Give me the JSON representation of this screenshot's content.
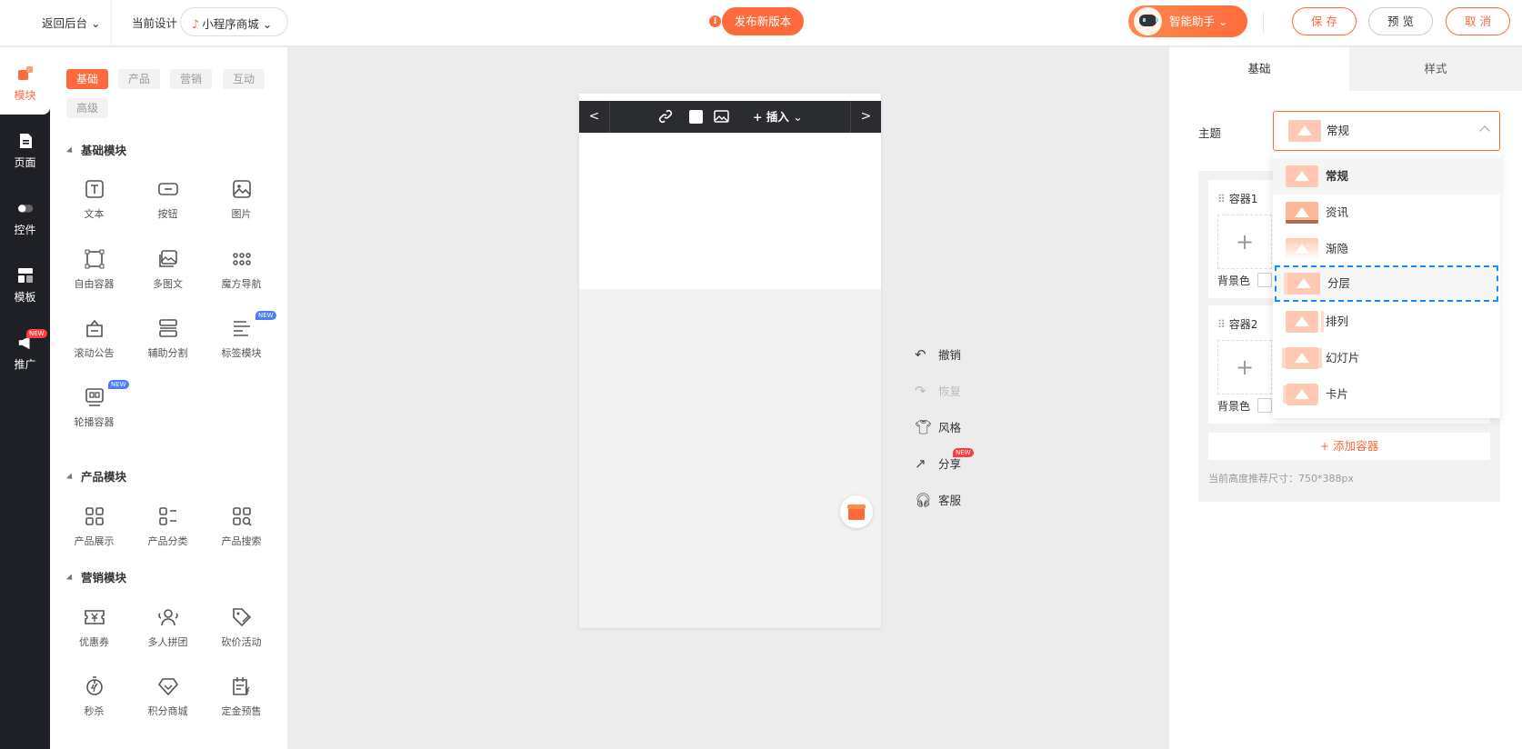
{
  "topbar": {
    "back": "返回后台",
    "current_design_label": "当前设计",
    "design_select": "小程序商城",
    "publish": "发布新版本",
    "warn_icon": "!",
    "ai": "智能助手",
    "save": "保 存",
    "preview": "预 览",
    "cancel": "取 消"
  },
  "leftnav": {
    "items": [
      {
        "label": "模块",
        "icon": "blocks-icon"
      },
      {
        "label": "页面",
        "icon": "page-icon"
      },
      {
        "label": "控件",
        "icon": "toggle-icon"
      },
      {
        "label": "模板",
        "icon": "template-icon"
      },
      {
        "label": "推广",
        "icon": "megaphone-icon",
        "badge": "NEW"
      }
    ]
  },
  "modules": {
    "chips": [
      "基础",
      "产品",
      "营销",
      "互动",
      "高级"
    ],
    "sections": [
      {
        "title": "基础模块",
        "items": [
          "文本",
          "按钮",
          "图片",
          "自由容器",
          "多图文",
          "魔方导航",
          "滚动公告",
          "辅助分割",
          "标签模块",
          "轮播容器"
        ]
      },
      {
        "title": "产品模块",
        "items": [
          "产品展示",
          "产品分类",
          "产品搜索"
        ]
      },
      {
        "title": "营销模块",
        "items": [
          "优惠券",
          "多人拼团",
          "砍价活动",
          "秒杀",
          "积分商城",
          "定金预售"
        ]
      }
    ],
    "new_badge": "NEW"
  },
  "editor": {
    "prev": "<",
    "next": ">",
    "insert": "+ 插入"
  },
  "side_actions": {
    "undo": "撤销",
    "redo": "恢复",
    "style": "风格",
    "share": "分享",
    "share_badge": "NEW",
    "service": "客服"
  },
  "right": {
    "tab_basic": "基础",
    "tab_style": "样式",
    "theme_label": "主题",
    "theme_value": "常规",
    "options": [
      "常规",
      "资讯",
      "渐隐",
      "分层",
      "排列",
      "幻灯片",
      "卡片"
    ],
    "container1": "容器1",
    "container2": "容器2",
    "plus": "+",
    "bg_label": "背景色",
    "add_container": "+ 添加容器",
    "hint": "当前高度推荐尺寸：750*388px"
  },
  "colors": {
    "accent": "#ff6a3d",
    "dark_nav": "#1e2026",
    "highlight_border": "#1a8cff"
  }
}
